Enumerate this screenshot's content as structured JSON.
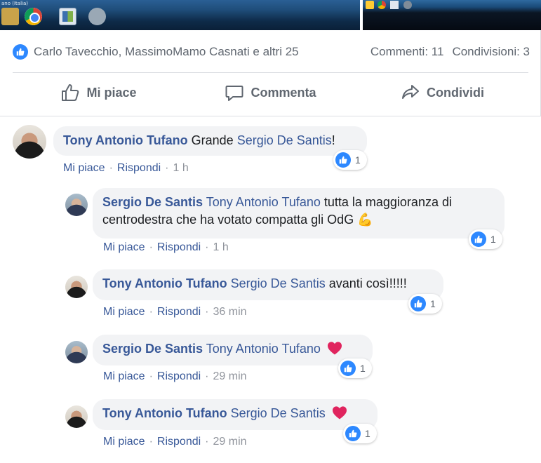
{
  "taskbar": {
    "caption": "ano (Italia)"
  },
  "post": {
    "likes_names": "Carlo Tavecchio, MassimoMamo Casnati e altri 25",
    "comments_count": "Commenti: 11",
    "shares_count": "Condivisioni: 3",
    "actions": {
      "like": "Mi piace",
      "comment": "Commenta",
      "share": "Condividi"
    }
  },
  "comments": [
    {
      "author": "Tony Antonio Tufano",
      "text_before": "Grande ",
      "mention": "Sergio De Santis",
      "text_after": "!",
      "reactions": "1",
      "like": "Mi piace",
      "reply": "Rispondi",
      "time": "1 h"
    },
    {
      "author": "Sergio De Santis",
      "mention": "Tony Antonio Tufano",
      "text_line1": " tutta la maggioranza di",
      "text_line2": "centrodestra che ha votato compatta gli OdG ",
      "emoji": "💪",
      "reactions": "1",
      "like": "Mi piace",
      "reply": "Rispondi",
      "time": "1 h"
    },
    {
      "author": "Tony Antonio Tufano",
      "mention": "Sergio De Santis",
      "text_after": " avanti così!!!!!",
      "reactions": "1",
      "like": "Mi piace",
      "reply": "Rispondi",
      "time": "36 min"
    },
    {
      "author": "Sergio De Santis",
      "mention": "Tony Antonio Tufano",
      "reactions": "1",
      "like": "Mi piace",
      "reply": "Rispondi",
      "time": "29 min"
    },
    {
      "author": "Tony Antonio Tufano",
      "mention": "Sergio De Santis",
      "reactions": "1",
      "like": "Mi piace",
      "reply": "Rispondi",
      "time": "29 min"
    }
  ],
  "colors": {
    "link": "#385898",
    "like_blue": "#2d88ff",
    "bubble": "#f2f3f5",
    "muted": "#606770",
    "heart": "#e0245e"
  }
}
